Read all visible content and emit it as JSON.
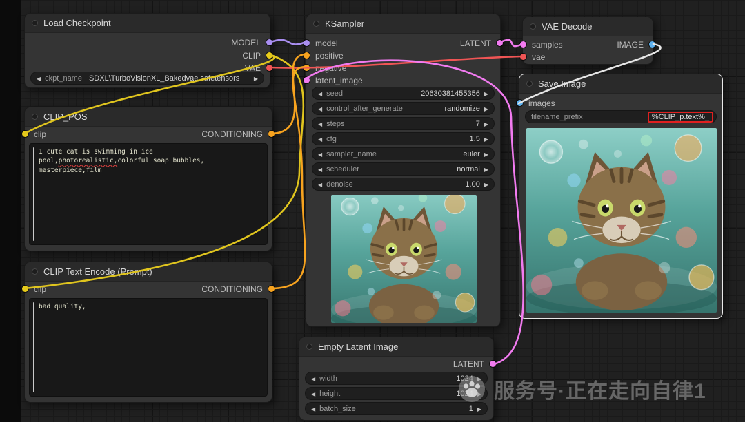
{
  "watermark": {
    "text": "服务号·正在走向自律1"
  },
  "load_checkpoint": {
    "title": "Load Checkpoint",
    "outputs": [
      "MODEL",
      "CLIP",
      "VAE"
    ],
    "ckpt_label": "ckpt_name",
    "ckpt_value": "SDXL\\TurboVisionXL_Bakedvae.safetensors"
  },
  "clip_pos": {
    "title": "CLIP_POS",
    "input_label": "clip",
    "output_label": "CONDITIONING",
    "prompt_part1": "1 cute cat is swimming in ice pool,",
    "prompt_part2": "photorealistic,",
    "prompt_part3": "colorful soap bubbles, masterpiece,film"
  },
  "clip_neg": {
    "title": "CLIP Text Encode (Prompt)",
    "input_label": "clip",
    "output_label": "CONDITIONING",
    "prompt": "bad quality,"
  },
  "ksampler": {
    "title": "KSampler",
    "inputs": [
      "model",
      "positive",
      "negative",
      "latent_image"
    ],
    "output_label": "LATENT",
    "widgets": [
      {
        "label": "seed",
        "value": "20630381455356"
      },
      {
        "label": "control_after_generate",
        "value": "randomize"
      },
      {
        "label": "steps",
        "value": "7"
      },
      {
        "label": "cfg",
        "value": "1.5"
      },
      {
        "label": "sampler_name",
        "value": "euler"
      },
      {
        "label": "scheduler",
        "value": "normal"
      },
      {
        "label": "denoise",
        "value": "1.00"
      }
    ]
  },
  "empty_latent": {
    "title": "Empty Latent Image",
    "output_label": "LATENT",
    "widgets": [
      {
        "label": "width",
        "value": "1024"
      },
      {
        "label": "height",
        "value": "1024"
      },
      {
        "label": "batch_size",
        "value": "1"
      }
    ]
  },
  "vae_decode": {
    "title": "VAE Decode",
    "inputs": [
      "samples",
      "vae"
    ],
    "output_label": "IMAGE"
  },
  "save_image": {
    "title": "Save Image",
    "input_label": "images",
    "filename_label": "filename_prefix",
    "filename_value": "%CLIP_p.text%_"
  },
  "colors": {
    "model": "#a98ef0",
    "clip": "#e8cc1a",
    "vae": "#f05555",
    "conditioning": "#f7a31f",
    "latent": "#f27bf0",
    "image": "#5db2f0",
    "annotation": "#e02020"
  }
}
